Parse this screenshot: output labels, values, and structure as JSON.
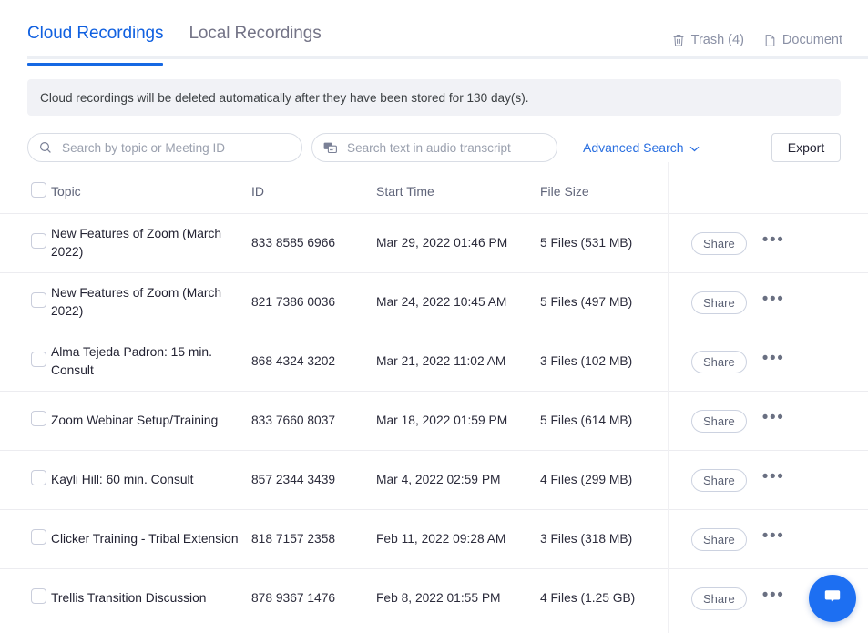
{
  "tabs": [
    {
      "label": "Cloud Recordings",
      "active": true
    },
    {
      "label": "Local Recordings",
      "active": false
    }
  ],
  "header_links": [
    {
      "label": "Trash (4)",
      "icon": "trash-icon"
    },
    {
      "label": "Document",
      "icon": "document-icon"
    }
  ],
  "notice": {
    "text": "Cloud recordings will be deleted automatically after they have been stored for 130 day(s)."
  },
  "toolbar": {
    "topic_search_placeholder": "Search by topic or Meeting ID",
    "topic_search_value": "",
    "transcript_search_placeholder": "Search text in audio transcript",
    "transcript_search_value": "",
    "advanced_search_label": "Advanced Search",
    "export_label": "Export"
  },
  "table": {
    "columns": [
      "Topic",
      "ID",
      "Start Time",
      "File Size"
    ],
    "share_label": "Share",
    "rows": [
      {
        "topic": "New Features of Zoom (March 2022)",
        "id": "833 8585 6966",
        "start_time": "Mar 29, 2022 01:46 PM",
        "file_size": "5 Files (531 MB)"
      },
      {
        "topic": "New Features of Zoom (March 2022)",
        "id": "821 7386 0036",
        "start_time": "Mar 24, 2022 10:45 AM",
        "file_size": "5 Files (497 MB)"
      },
      {
        "topic": "Alma Tejeda Padron: 15 min. Consult",
        "id": "868 4324 3202",
        "start_time": "Mar 21, 2022 11:02 AM",
        "file_size": "3 Files (102 MB)"
      },
      {
        "topic": "Zoom Webinar Setup/Training",
        "id": "833 7660 8037",
        "start_time": "Mar 18, 2022 01:59 PM",
        "file_size": "5 Files (614 MB)"
      },
      {
        "topic": "Kayli Hill: 60 min. Consult",
        "id": "857 2344 3439",
        "start_time": "Mar 4, 2022 02:59 PM",
        "file_size": "4 Files (299 MB)"
      },
      {
        "topic": "Clicker Training - Tribal Extension",
        "id": "818 7157 2358",
        "start_time": "Feb 11, 2022 09:28 AM",
        "file_size": "3 Files (318 MB)"
      },
      {
        "topic": "Trellis Transition Discussion",
        "id": "878 9367 1476",
        "start_time": "Feb 8, 2022 01:55 PM",
        "file_size": "4 Files (1.25 GB)"
      }
    ]
  },
  "chat_widget": {
    "icon": "chat-bubble-icon",
    "color": "#1d6ff2"
  },
  "colors": {
    "accent": "#1668e3",
    "link": "#2a6fe0",
    "notice_bg": "#f1f2f6",
    "border": "#ececf0"
  }
}
